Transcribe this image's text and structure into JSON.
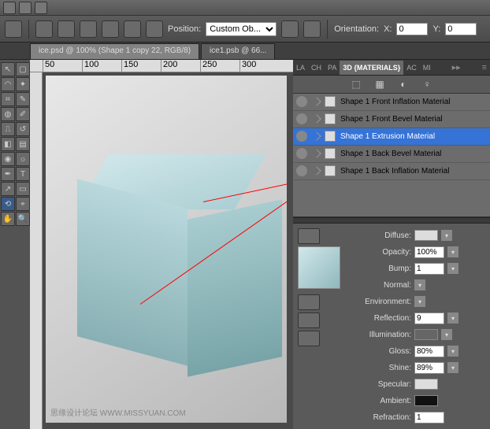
{
  "menubar": {
    "app_icon": "PS"
  },
  "toolbar": {
    "position_label": "Position:",
    "position_value": "Custom Ob...",
    "orientation_label": "Orientation:",
    "x_label": "X:",
    "x_value": "0",
    "y_label": "Y:",
    "y_value": "0"
  },
  "doc_tabs": [
    {
      "label": "ice.psd @ 100% (Shape 1 copy 22, RGB/8)",
      "active": true
    },
    {
      "label": "ice1.psb @ 66...",
      "active": false
    }
  ],
  "ruler_marks": [
    "50",
    "100",
    "150",
    "200",
    "250",
    "300"
  ],
  "watermark": "思缘设计论坛   WWW.MISSYUAN.COM",
  "panel_tabs": [
    "LA",
    "CH",
    "PA",
    "3D {MATERIALS}",
    "AC",
    "MI"
  ],
  "panel_active": "3D {MATERIALS}",
  "materials": [
    {
      "name": "Shape 1 Front Inflation Material",
      "selected": false
    },
    {
      "name": "Shape 1 Front Bevel Material",
      "selected": false
    },
    {
      "name": "Shape 1 Extrusion Material",
      "selected": true
    },
    {
      "name": "Shape 1 Back Bevel Material",
      "selected": false
    },
    {
      "name": "Shape 1 Back Inflation Material",
      "selected": false
    }
  ],
  "props": {
    "diffuse": {
      "label": "Diffuse:"
    },
    "opacity": {
      "label": "Opacity:",
      "value": "100%"
    },
    "bump": {
      "label": "Bump:",
      "value": "1"
    },
    "normal": {
      "label": "Normal:"
    },
    "environment": {
      "label": "Environment:"
    },
    "reflection": {
      "label": "Reflection:",
      "value": "9"
    },
    "illumination": {
      "label": "Illumination:"
    },
    "gloss": {
      "label": "Gloss:",
      "value": "80%"
    },
    "shine": {
      "label": "Shine:",
      "value": "89%"
    },
    "specular": {
      "label": "Specular:"
    },
    "ambient": {
      "label": "Ambient:"
    },
    "refraction": {
      "label": "Refraction:",
      "value": "1"
    }
  }
}
